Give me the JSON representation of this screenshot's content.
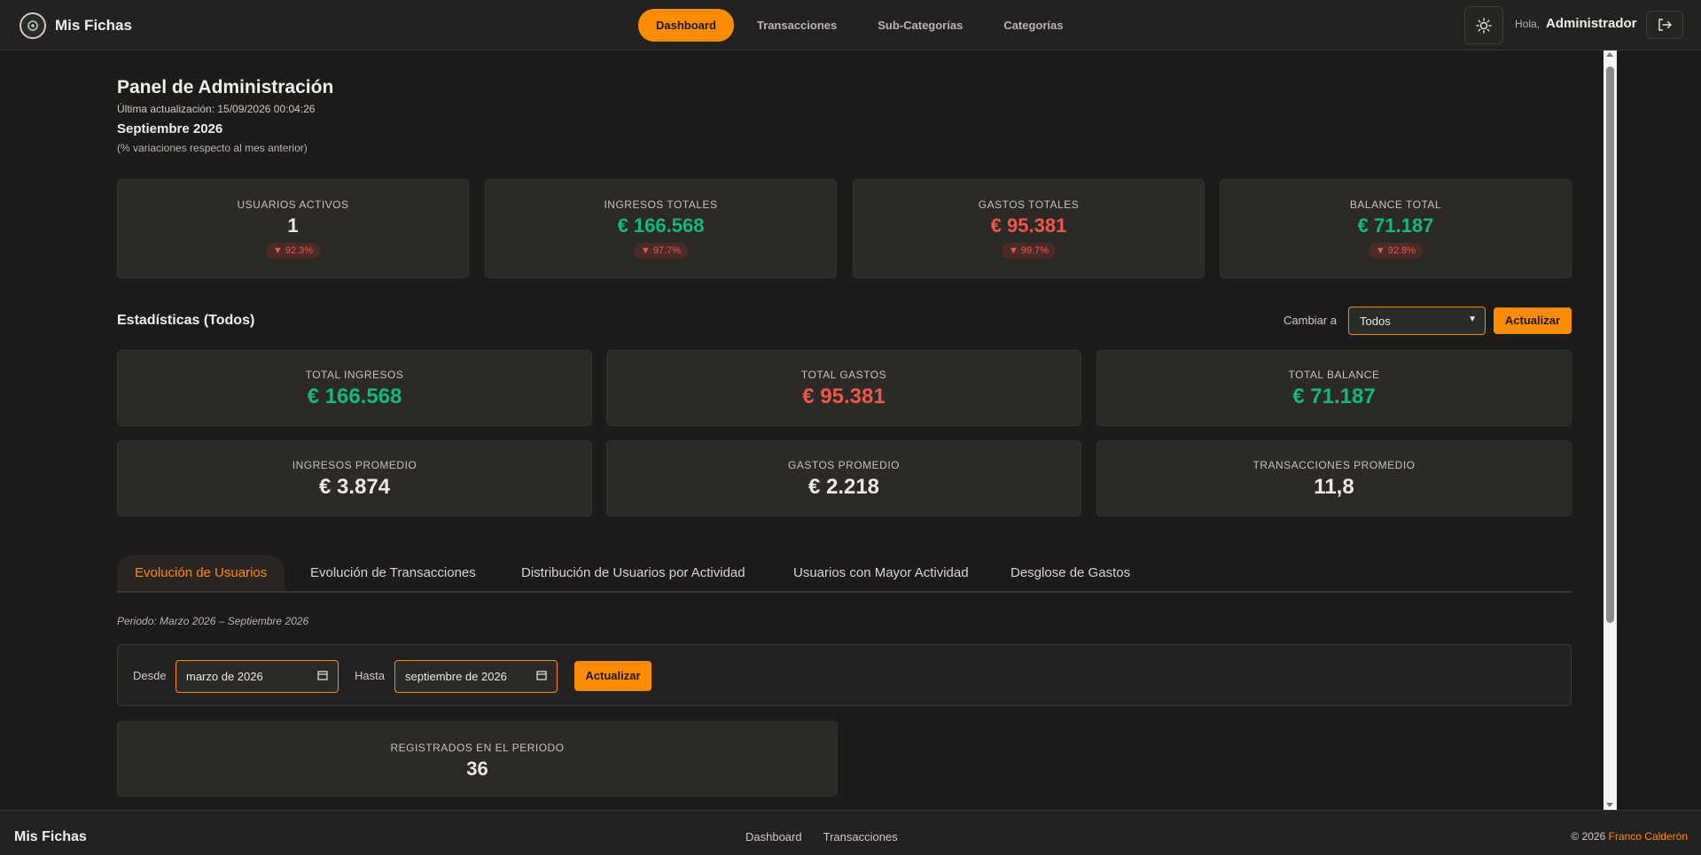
{
  "header": {
    "brand": "Mis Fichas",
    "nav": [
      "Dashboard",
      "Transacciones",
      "Sub-Categorías",
      "Categorías"
    ],
    "active_nav": "Dashboard",
    "greeting": "Hola,",
    "username": "Administrador"
  },
  "page": {
    "title": "Panel de Administración",
    "last_update": "Última actualización: 15/09/2026 00:04:26",
    "month": "Septiembre 2026",
    "variations_note": "(% variaciones respecto al mes anterior)"
  },
  "kpis": [
    {
      "label": "USUARIOS ACTIVOS",
      "value": "1",
      "delta": "▼ 92.3%",
      "tone": "neutral"
    },
    {
      "label": "INGRESOS TOTALES",
      "value": "€ 166.568",
      "delta": "▼ 97.7%",
      "tone": "green"
    },
    {
      "label": "GASTOS TOTALES",
      "value": "€ 95.381",
      "delta": "▼ 99.7%",
      "tone": "red"
    },
    {
      "label": "BALANCE TOTAL",
      "value": "€ 71.187",
      "delta": "▼ 92.8%",
      "tone": "green"
    }
  ],
  "stats": {
    "title": "Estadísticas (Todos)",
    "switch_label": "Cambiar a",
    "select_value": "Todos",
    "update_label": "Actualizar",
    "cards": [
      {
        "label": "TOTAL INGRESOS",
        "value": "€ 166.568",
        "tone": "green"
      },
      {
        "label": "TOTAL GASTOS",
        "value": "€ 95.381",
        "tone": "red"
      },
      {
        "label": "TOTAL BALANCE",
        "value": "€ 71.187",
        "tone": "green"
      },
      {
        "label": "INGRESOS PROMEDIO",
        "value": "€ 3.874",
        "tone": "neutral"
      },
      {
        "label": "GASTOS PROMEDIO",
        "value": "€ 2.218",
        "tone": "neutral"
      },
      {
        "label": "TRANSACCIONES PROMEDIO",
        "value": "11,8",
        "tone": "neutral"
      }
    ]
  },
  "tabs": [
    "Evolución de Usuarios",
    "Evolución de Transacciones",
    "Distribución de Usuarios por Actividad",
    "Usuarios con Mayor Actividad",
    "Desglose de Gastos"
  ],
  "filter": {
    "period": "Periodo: Marzo 2026 – Septiembre 2026",
    "from_label": "Desde",
    "from_value": "marzo de 2026",
    "to_label": "Hasta",
    "to_value": "septiembre de 2026",
    "update_label": "Actualizar"
  },
  "registered": {
    "label": "REGISTRADOS EN EL PERIODO",
    "value": "36"
  },
  "footer": {
    "brand": "Mis Fichas",
    "links": [
      "Dashboard",
      "Transacciones"
    ],
    "copyright": "© 2026",
    "author": "Franco Calderón"
  },
  "colors": {
    "accent": "#ff8c00",
    "positive": "#14b87a",
    "negative": "#f0564a",
    "background": "#1c1b19"
  }
}
